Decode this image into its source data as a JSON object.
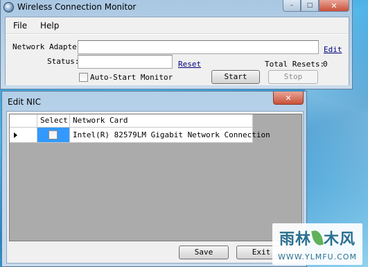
{
  "main_window": {
    "title": "Wireless Connection Monitor",
    "caption_buttons": {
      "minimize": "–",
      "maximize": "□",
      "close": "✕"
    }
  },
  "menu": {
    "file": "File",
    "help": "Help"
  },
  "form": {
    "network_adapter_label": "Network Adapter:",
    "network_adapter_value": "",
    "edit_link": "Edit",
    "status_label": "Status:",
    "status_value": "",
    "reset_link": "Reset",
    "total_resets_label": "Total Resets:",
    "total_resets_value": "0",
    "auto_start_label": "Auto-Start Monitor",
    "auto_start_checked": false,
    "start_button": "Start",
    "stop_button": "Stop"
  },
  "nic_dialog": {
    "title": "Edit NIC",
    "close": "✕",
    "columns": [
      "Select",
      "Network Card"
    ],
    "rows": [
      {
        "selected": false,
        "card": "Intel(R) 82579LM Gigabit Network Connection"
      }
    ],
    "save_button": "Save",
    "exit_button": "Exit"
  },
  "watermark": {
    "logo_left": "雨林",
    "logo_right": "木风",
    "url": "WWW.YLMFU.COM"
  },
  "colors": {
    "selection": "#3399ff",
    "link": "#000080",
    "grid_bg": "#ababab"
  }
}
